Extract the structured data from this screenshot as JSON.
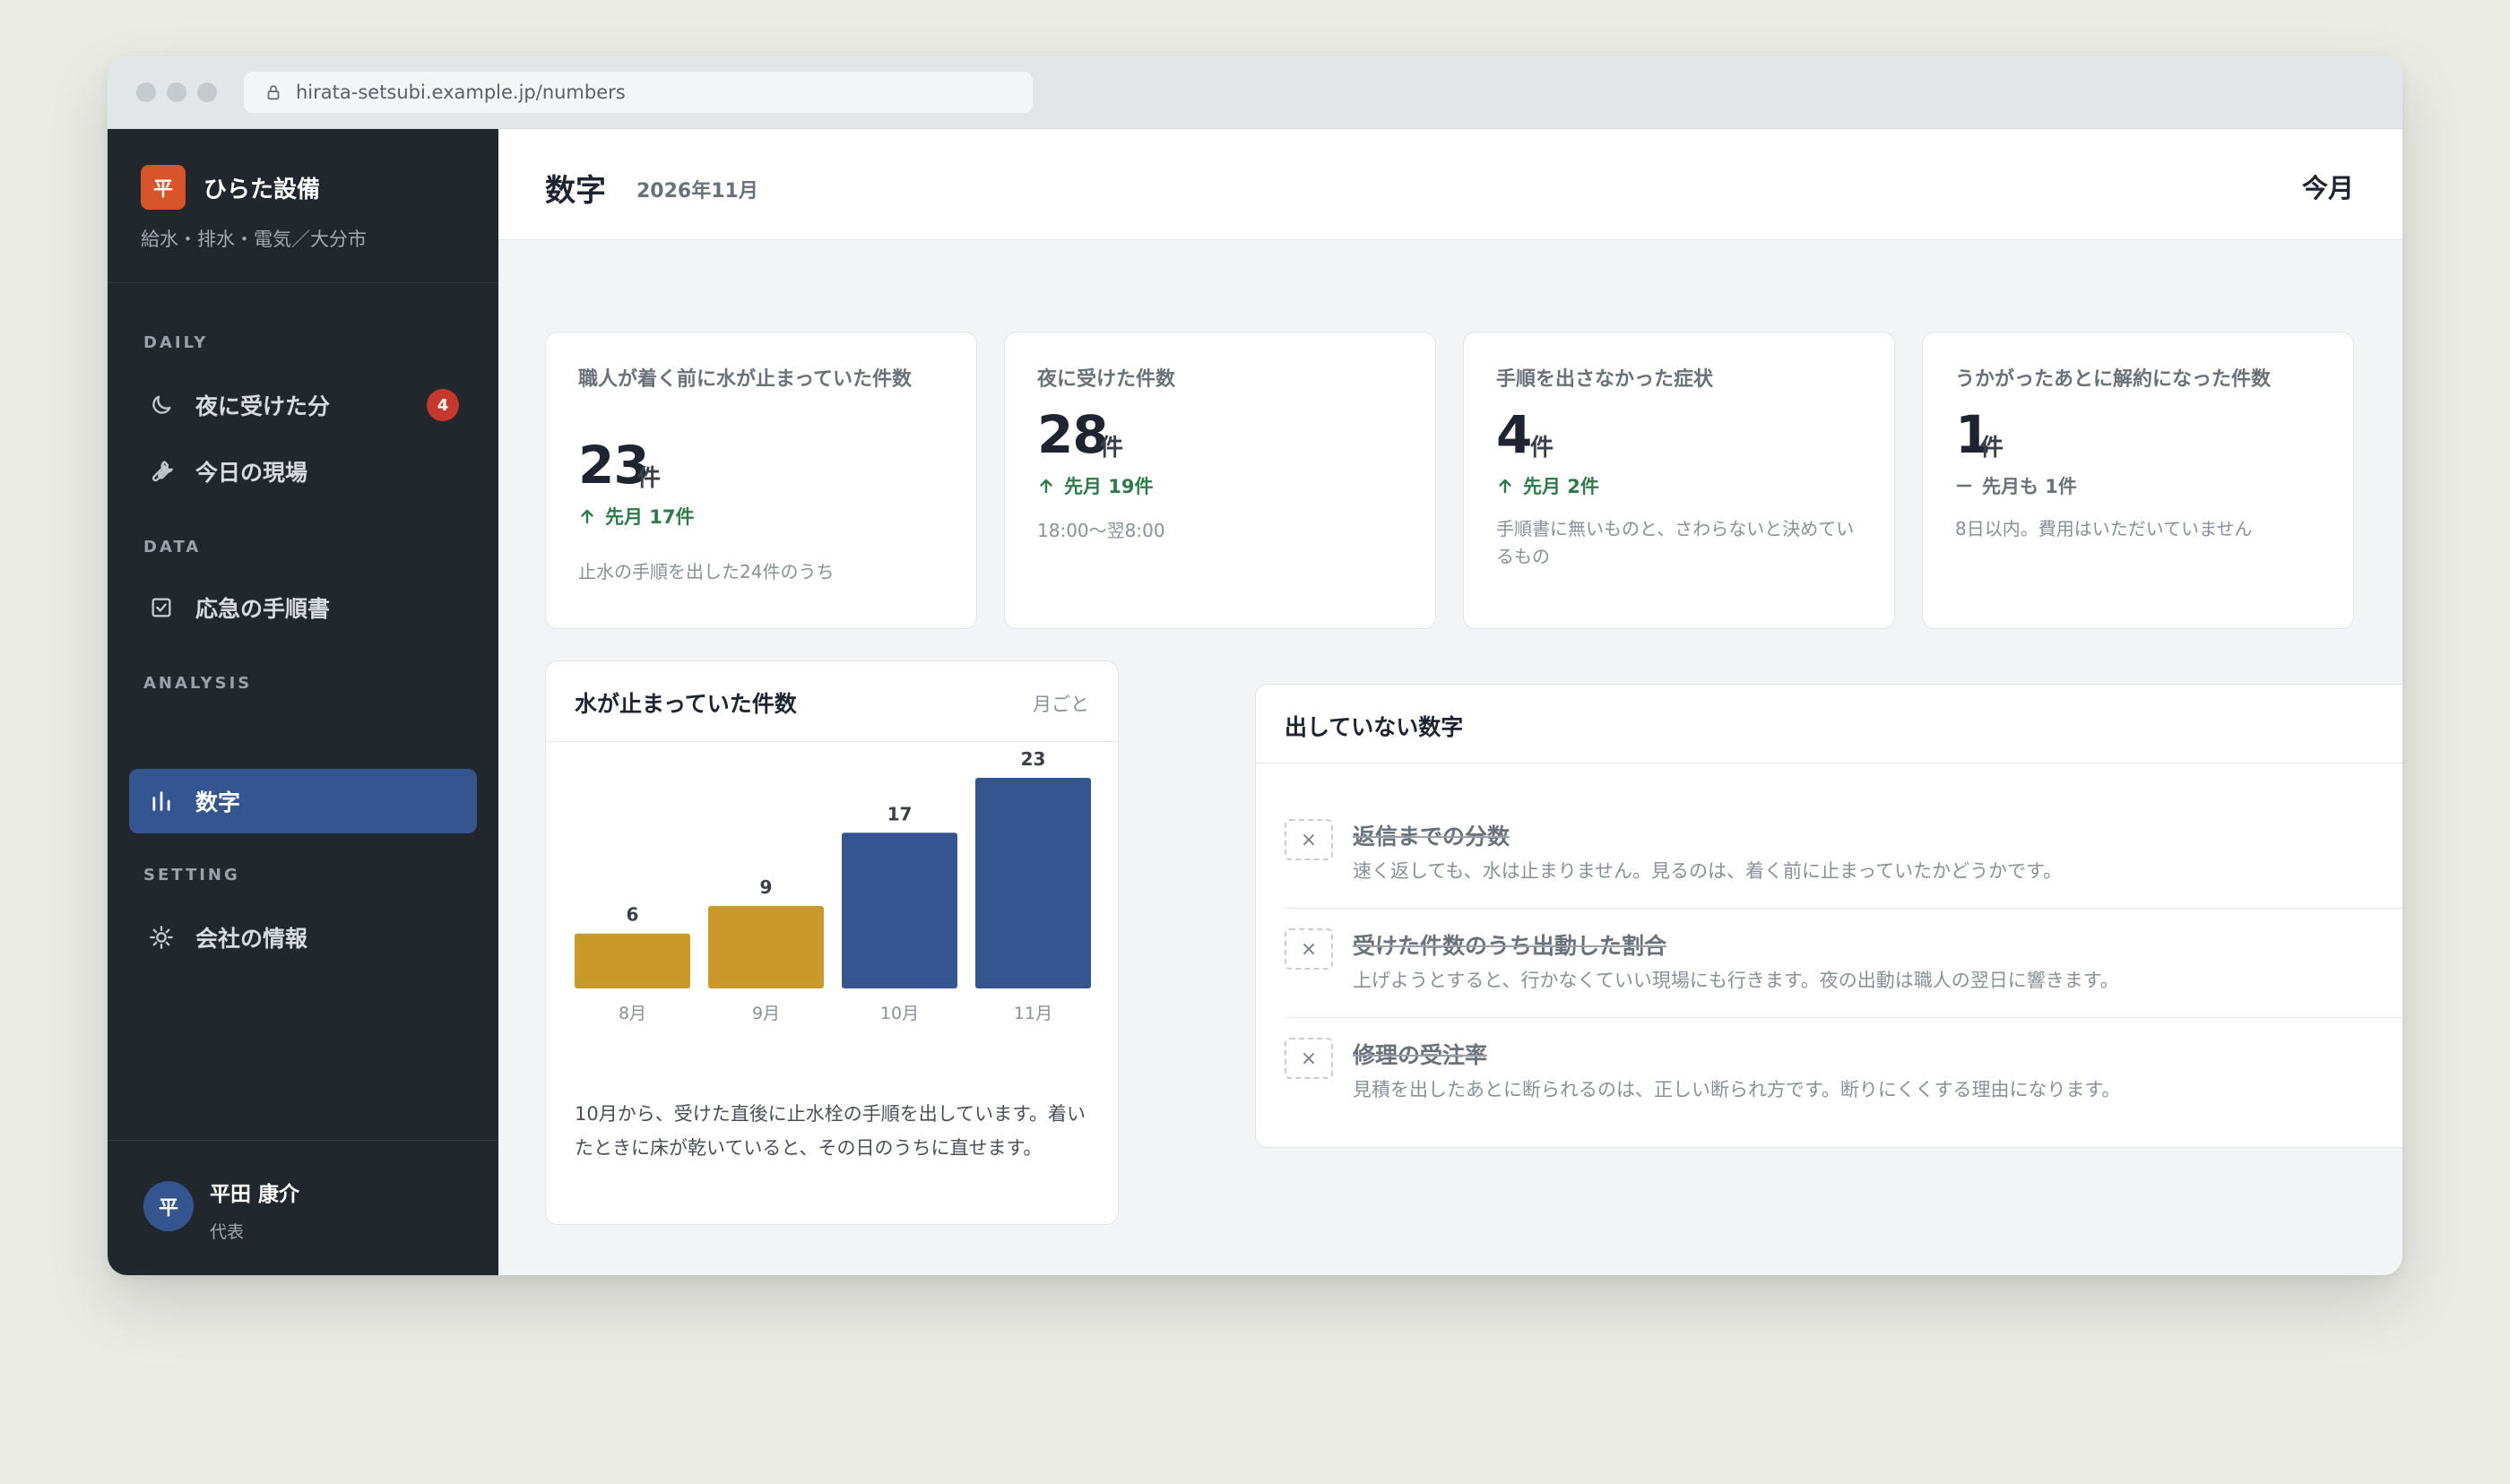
{
  "browser": {
    "url": "hirata-setsubi.example.jp/numbers"
  },
  "company": {
    "logo_char": "平",
    "name": "ひらた設備",
    "subtitle": "給水・排水・電気／大分市"
  },
  "nav": {
    "sections": [
      {
        "label": "DAILY"
      },
      {
        "label": "DATA"
      },
      {
        "label": "ANALYSIS"
      },
      {
        "label": "SETTING"
      }
    ],
    "items": [
      {
        "label": "夜に受けた分",
        "badge": "4",
        "icon": "moon-icon"
      },
      {
        "label": "今日の現場",
        "icon": "wrench-icon"
      },
      {
        "label": "応急の手順書",
        "icon": "checkbox-icon"
      },
      {
        "label": "数字",
        "icon": "bar-chart-icon",
        "active": true
      },
      {
        "label": "会社の情報",
        "icon": "sun-gear-icon"
      }
    ]
  },
  "user": {
    "avatar_char": "平",
    "name": "平田 康介",
    "role": "代表"
  },
  "header": {
    "title": "数字",
    "date": "2026年11月",
    "period": "今月"
  },
  "kpis": [
    {
      "label": "職人が着く前に水が止まっていた件数",
      "value": "23",
      "unit": "件",
      "delta": "先月 17件",
      "trend": "up",
      "note": "止水の手順を出した24件のうち"
    },
    {
      "label": "夜に受けた件数",
      "value": "28",
      "unit": "件",
      "delta": "先月 19件",
      "trend": "up",
      "note": "18:00〜翌8:00"
    },
    {
      "label": "手順を出さなかった症状",
      "value": "4",
      "unit": "件",
      "delta": "先月 2件",
      "trend": "up",
      "note": "手順書に無いものと、さわらないと決めているもの"
    },
    {
      "label": "うかがったあとに解約になった件数",
      "value": "1",
      "unit": "件",
      "delta": "先月も 1件",
      "trend": "flat",
      "note": "8日以内。費用はいただいていません"
    }
  ],
  "chart_card": {
    "title": "水が止まっていた件数",
    "meta": "月ごと",
    "caption": "10月から、受けた直後に止水栓の手順を出しています。着いたときに床が乾いていると、その日のうちに直せます。"
  },
  "chart_data": {
    "type": "bar",
    "title": "水が止まっていた件数",
    "categories": [
      "8月",
      "9月",
      "10月",
      "11月"
    ],
    "values": [
      6,
      9,
      17,
      23
    ],
    "colors": [
      "#c99a29",
      "#c99a29",
      "#34558f",
      "#34558f"
    ],
    "xlabel": "",
    "ylabel": "",
    "grid": false
  },
  "omitted": {
    "title": "出していない数字",
    "items": [
      {
        "title": "返信までの分数",
        "desc": "速く返しても、水は止まりません。見るのは、着く前に止まっていたかどうかです。"
      },
      {
        "title": "受けた件数のうち出動した割合",
        "desc": "上げようとすると、行かなくていい現場にも行きます。夜の出動は職人の翌日に響きます。"
      },
      {
        "title": "修理の受注率",
        "desc": "見積を出したあとに断られるのは、正しい断られ方です。断りにくくする理由になります。"
      }
    ]
  },
  "colors": {
    "accent": "#34558f",
    "sidebar_bg": "#22272e",
    "brand": "#d9542b",
    "badge": "#c4392c",
    "positive": "#2f7a4a",
    "bar_old": "#c99a29"
  }
}
